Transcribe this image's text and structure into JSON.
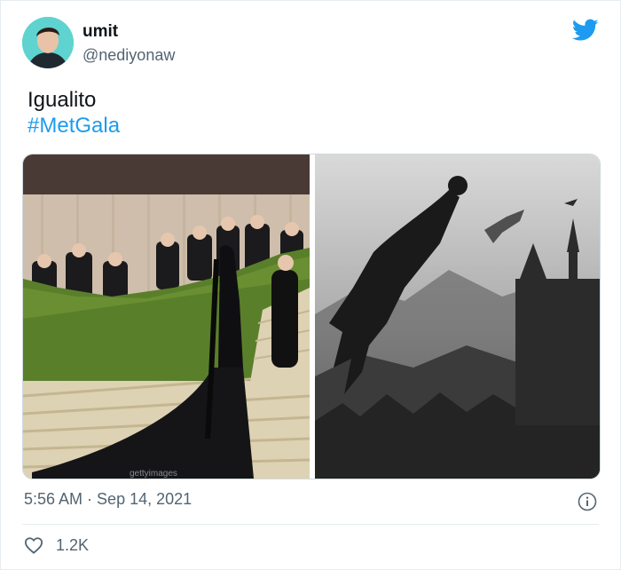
{
  "author": {
    "name": "umit",
    "handle": "@nediyonaw"
  },
  "tweet": {
    "text": "Igualito",
    "hashtag": "#MetGala"
  },
  "media": {
    "left_watermark": "gettyimages"
  },
  "meta": {
    "time": "5:56 AM",
    "separator": " · ",
    "date": "Sep 14, 2021"
  },
  "engagement": {
    "likes": "1.2K"
  },
  "colors": {
    "accent": "#1d9bf0",
    "text_primary": "#0f1419",
    "text_secondary": "#536471",
    "avatar_bg": "#5fd3d0"
  },
  "icons": {
    "brand": "twitter-bird-icon",
    "info": "info-icon",
    "like": "heart-outline-icon"
  }
}
